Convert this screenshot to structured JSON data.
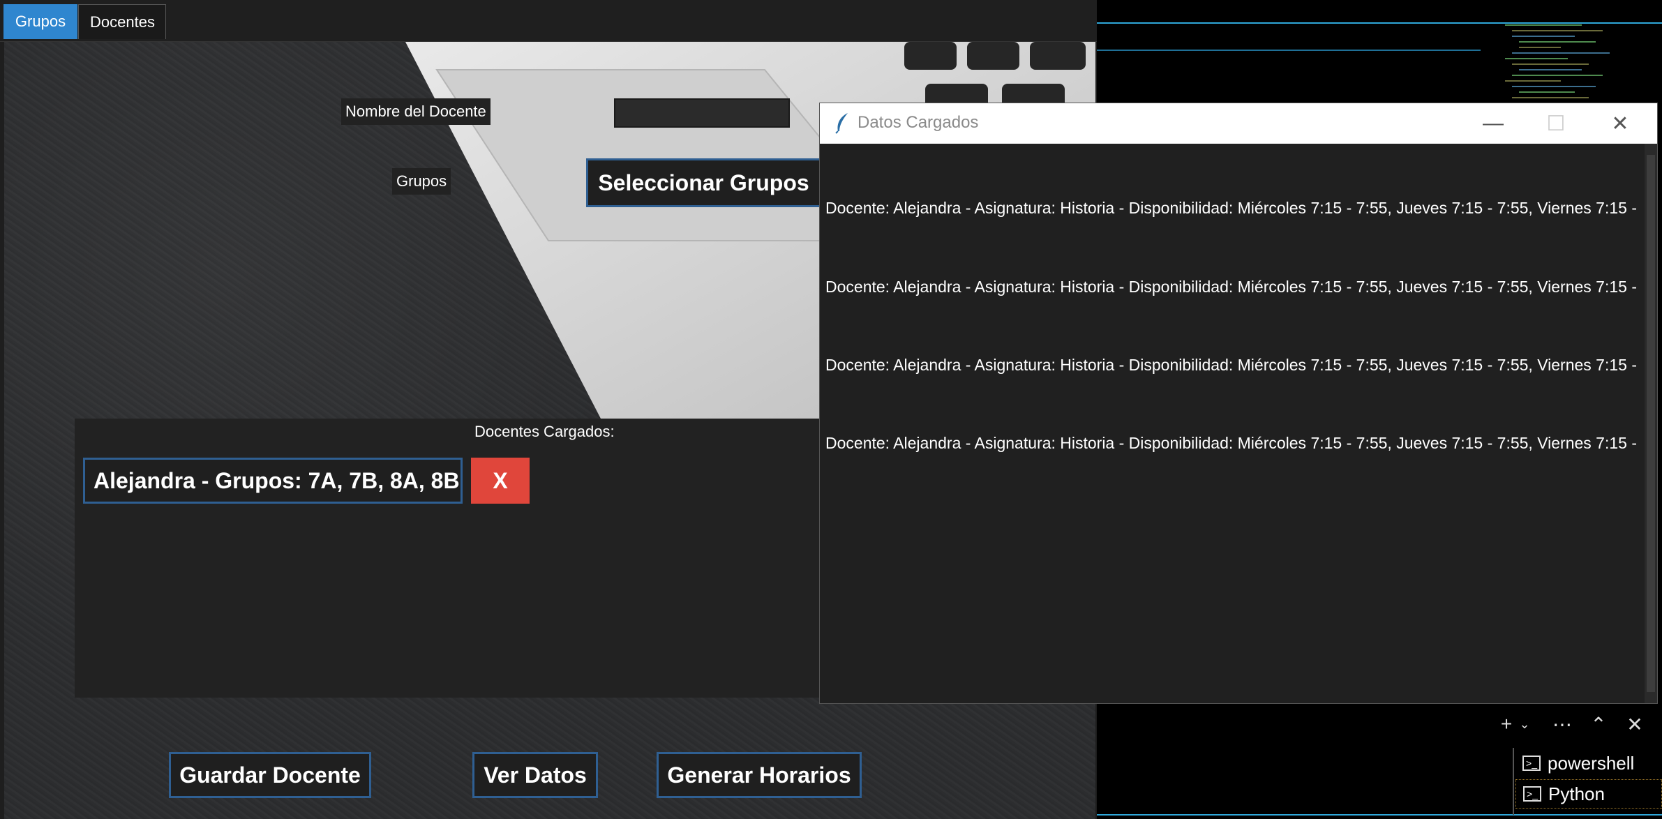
{
  "tabs": [
    {
      "label": "Grupos",
      "active": true
    },
    {
      "label": "Docentes",
      "active": false
    }
  ],
  "form": {
    "name_label": "Nombre del Docente",
    "name_value": "",
    "groups_label": "Grupos",
    "select_groups_button": "Seleccionar Grupos"
  },
  "list": {
    "title": "Docentes Cargados:",
    "items": [
      {
        "text": "Alejandra - Grupos: 7A, 7B, 8A, 8B",
        "delete_label": "X"
      }
    ]
  },
  "actions": {
    "save": "Guardar Docente",
    "view": "Ver Datos",
    "generate": "Generar Horarios"
  },
  "popup": {
    "title": "Datos Cargados",
    "lines": [
      "Docente: Alejandra - Asignatura: Historia - Disponibilidad: Miércoles 7:15 - 7:55, Jueves 7:15 - 7:55, Viernes 7:15 -",
      "Docente: Alejandra - Asignatura: Historia - Disponibilidad: Miércoles 7:15 - 7:55, Jueves 7:15 - 7:55, Viernes 7:15 -",
      "Docente: Alejandra - Asignatura: Historia - Disponibilidad: Miércoles 7:15 - 7:55, Jueves 7:15 - 7:55, Viernes 7:15 -",
      "Docente: Alejandra - Asignatura: Historia - Disponibilidad: Miércoles 7:15 - 7:55, Jueves 7:15 - 7:55, Viernes 7:15 -"
    ]
  },
  "terminal": {
    "items": [
      "powershell",
      "Python"
    ]
  },
  "colors": {
    "accent": "#2f86cf",
    "button_border": "#2f5f92",
    "delete": "#e0463b",
    "terminal_line": "#2fa7d9"
  }
}
